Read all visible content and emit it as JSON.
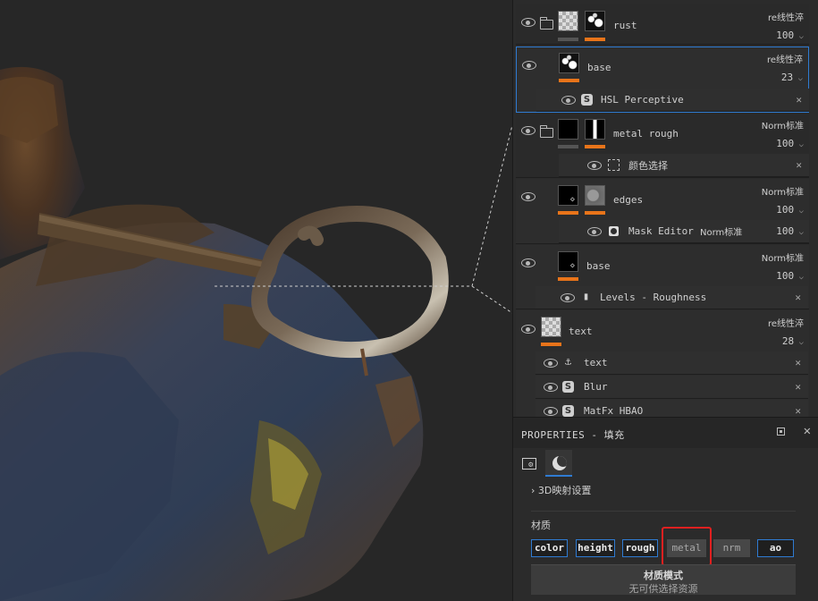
{
  "layers": [
    {
      "name": "rust",
      "blend": "re线性淬",
      "opacity": "100"
    },
    {
      "name": "base",
      "blend": "re线性淬",
      "opacity": "23",
      "effects": [
        {
          "icon": "substance-icon",
          "name": "HSL Perceptive"
        }
      ]
    },
    {
      "name": "metal rough",
      "blend": "Norm标准",
      "opacity": "100",
      "effects": [
        {
          "icon": "selection-icon",
          "name": "颜色选择"
        }
      ]
    },
    {
      "name": "edges",
      "blend": "Norm标准",
      "opacity": "100",
      "effects": [
        {
          "icon": "mask-editor-icon",
          "name": "Mask Editor",
          "blend": "Norm标准",
          "opacity": "100"
        }
      ]
    },
    {
      "name": "base",
      "blend": "Norm标准",
      "opacity": "100",
      "effects": [
        {
          "icon": "levels-icon",
          "name": "Levels - Roughness"
        }
      ]
    },
    {
      "name": "text",
      "blend": "re线性淬",
      "opacity": "28",
      "effects": [
        {
          "icon": "anchor-icon",
          "name": "text"
        },
        {
          "icon": "substance-icon",
          "name": "Blur"
        },
        {
          "icon": "substance-icon",
          "name": "MatFx HBAO"
        }
      ]
    }
  ],
  "properties": {
    "title": "PROPERTIES - 填充",
    "section_3d": "3D映射设置",
    "material_label": "材质",
    "channels": [
      {
        "label": "color",
        "enabled": true
      },
      {
        "label": "height",
        "enabled": true
      },
      {
        "label": "rough",
        "enabled": true
      },
      {
        "label": "metal",
        "enabled": false
      },
      {
        "label": "nrm",
        "enabled": false
      },
      {
        "label": "ao",
        "enabled": true
      }
    ],
    "material_mode_title": "材质模式",
    "material_mode_sub": "无可供选择资源"
  },
  "colors": {
    "accent": "#2f7bd2",
    "mask_bar": "#e8741a",
    "highlight": "#e02020"
  }
}
